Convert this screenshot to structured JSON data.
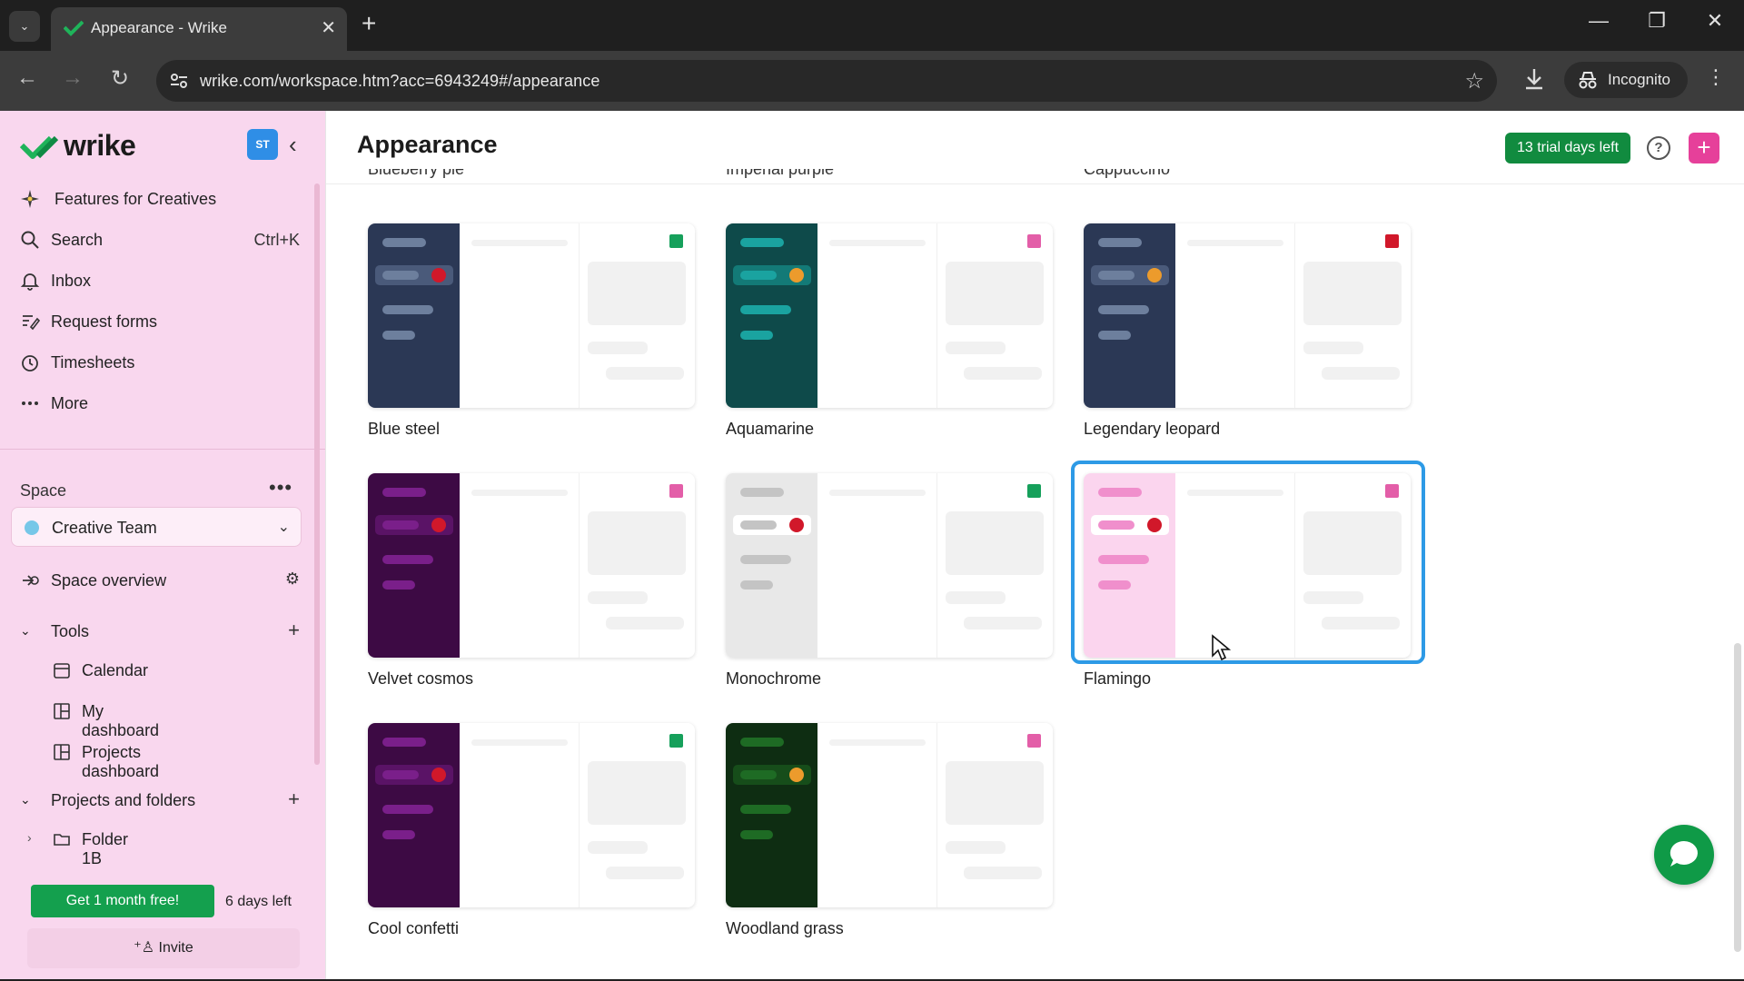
{
  "browser": {
    "tab_title": "Appearance - Wrike",
    "tab_close": "✕",
    "new_tab": "+",
    "url": "wrike.com/workspace.htm?acc=6943249#/appearance",
    "incognito_label": "Incognito"
  },
  "sidebar": {
    "brand": "wrike",
    "avatar": "ST",
    "nav": [
      {
        "label": "Features for Creatives",
        "icon": "sparkle-icon"
      },
      {
        "label": "Search",
        "icon": "search-icon",
        "shortcut": "Ctrl+K"
      },
      {
        "label": "Inbox",
        "icon": "bell-icon"
      },
      {
        "label": "Request forms",
        "icon": "form-icon"
      },
      {
        "label": "Timesheets",
        "icon": "clock-icon"
      },
      {
        "label": "More",
        "icon": "dots-icon"
      }
    ],
    "space_label": "Space",
    "space_name": "Creative Team",
    "space_overview": "Space overview",
    "tools_label": "Tools",
    "tools": [
      "Calendar",
      "My dashboard",
      "Projects dashboard"
    ],
    "projects_label": "Projects and folders",
    "folders": [
      "Folder 1B"
    ],
    "trial_button": "Get 1 month free!",
    "days_left": "6 days left",
    "invite": "Invite"
  },
  "main": {
    "title": "Appearance",
    "trial_badge": "13 trial days left",
    "help": "?",
    "add": "+",
    "cut_labels": [
      "Blueberry pie",
      "Imperial purple",
      "Cappuccino"
    ],
    "themes": [
      {
        "name": "Blue steel",
        "side": "#2b3855",
        "bar": "#6d7f9d",
        "hl": "#4a5a7a",
        "pip": "#d1182a",
        "sq": "#16a05b",
        "selected": false
      },
      {
        "name": "Aquamarine",
        "side": "#0e4a4a",
        "bar": "#1aa3a0",
        "hl": "#137a77",
        "pip": "#ec9b2c",
        "sq": "#e35ea8",
        "selected": false
      },
      {
        "name": "Legendary leopard",
        "side": "#2b3855",
        "bar": "#6d7f9d",
        "hl": "#4a5a7a",
        "pip": "#ec9b2c",
        "sq": "#d1182a",
        "selected": false
      },
      {
        "name": "Velvet cosmos",
        "side": "#3d0a44",
        "bar": "#7a1f8a",
        "hl": "#5a1366",
        "pip": "#d1182a",
        "sq": "#e35ea8",
        "selected": false
      },
      {
        "name": "Monochrome",
        "side": "#e8e8e8",
        "bar": "#c4c4c4",
        "hl": "#ffffff",
        "pip": "#d1182a",
        "sq": "#16a05b",
        "selected": false
      },
      {
        "name": "Flamingo",
        "side": "#fbd5ee",
        "bar": "#f08fcc",
        "hl": "#ffffff",
        "pip": "#d1182a",
        "sq": "#e35ea8",
        "selected": true
      },
      {
        "name": "Cool confetti",
        "side": "#3d0a44",
        "bar": "#7a1f8a",
        "hl": "#5a1366",
        "pip": "#d1182a",
        "sq": "#16a05b",
        "selected": false
      },
      {
        "name": "Woodland grass",
        "side": "#0e2d12",
        "bar": "#1e6b24",
        "hl": "#164d1a",
        "pip": "#ec9b2c",
        "sq": "#e35ea8",
        "selected": false
      }
    ]
  },
  "colors": {
    "accent_green": "#14a04e",
    "accent_pink": "#e6409a",
    "selection_blue": "#2d9ae6",
    "sidebar_bg": "#f9d7ee"
  }
}
